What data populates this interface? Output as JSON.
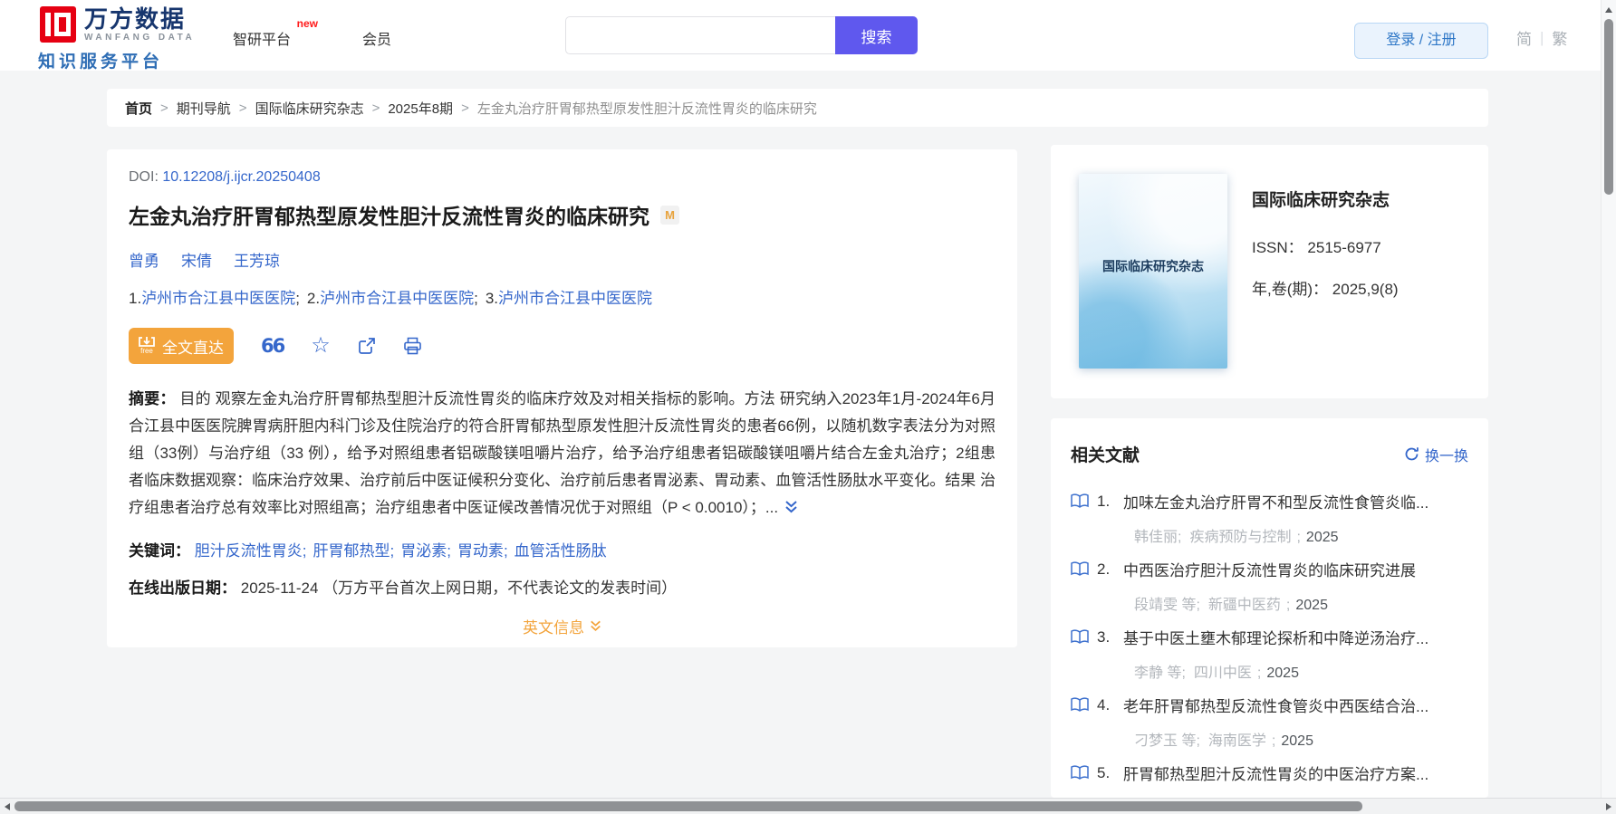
{
  "header": {
    "brand_cn": "万方数据",
    "brand_en": "WANFANG DATA",
    "subtitle": "知识服务平台",
    "nav": [
      {
        "label": "智研平台",
        "badge": "new"
      },
      {
        "label": "会员"
      }
    ],
    "search_value": "",
    "search_button": "搜索",
    "login": "登录 / 注册",
    "lang_divider": "|",
    "lang_simplified": "简",
    "lang_traditional": "繁"
  },
  "breadcrumb": {
    "separator": ">",
    "items": [
      "首页",
      "期刊导航",
      "国际临床研究杂志",
      "2025年8期",
      "左金丸治疗肝胃郁热型原发性胆汁反流性胃炎的临床研究"
    ]
  },
  "article": {
    "doi_label": "DOI: ",
    "doi": "10.12208/j.ijcr.20250408",
    "title": "左金丸治疗肝胃郁热型原发性胆汁反流性胃炎的临床研究",
    "badge": "M",
    "authors": [
      "曾勇",
      "宋倩",
      "王芳琼"
    ],
    "affil_sep": ";",
    "affiliations": [
      {
        "num": "1.",
        "name": "泸州市合江县中医医院"
      },
      {
        "num": "2.",
        "name": "泸州市合江县中医医院"
      },
      {
        "num": "3.",
        "name": "泸州市合江县中医医院"
      }
    ],
    "fulltext_label": "全文直达",
    "free_label": "free",
    "quote_icon": "66",
    "star_icon": "☆",
    "abstract_label": "摘要：",
    "abstract": "目的 观察左金丸治疗肝胃郁热型胆汁反流性胃炎的临床疗效及对相关指标的影响。方法 研究纳入2023年1月-2024年6月合江县中医医院脾胃病肝胆内科门诊及住院治疗的符合肝胃郁热型原发性胆汁反流性胃炎的患者66例，以随机数字表法分为对照组（33例）与治疗组（33 例），给予对照组患者铝碳酸镁咀嚼片治疗，给予治疗组患者铝碳酸镁咀嚼片结合左金丸治疗；2组患者临床数据观察：临床治疗效果、治疗前后中医证候积分变化、治疗前后患者胃泌素、胃动素、血管活性肠肽水平变化。结果 治疗组患者治疗总有效率比对照组高；治疗组患者中医证候改善情况优于对照组（P < 0.0010）；...",
    "keywords_label": "关键词：",
    "keyword_sep": ";",
    "keywords": [
      "胆汁反流性胃炎",
      "肝胃郁热型",
      "胃泌素",
      "胃动素",
      "血管活性肠肽"
    ],
    "pubdate_label": "在线出版日期：",
    "pubdate": "2025-11-24",
    "pubdate_note": "（万方平台首次上网日期，不代表论文的发表时间）",
    "english_info": "英文信息"
  },
  "journal": {
    "cover_text": "国际临床研究杂志",
    "name": "国际临床研究杂志",
    "issn_label": "ISSN：",
    "issn": "2515-6977",
    "vol_label": "年,卷(期)：",
    "vol": "2025,9(8)"
  },
  "related": {
    "title": "相关文献",
    "refresh_label": "换一换",
    "sep": ";",
    "items": [
      {
        "num": "1.",
        "title": "加味左金丸治疗肝胃不和型反流性食管炎临...",
        "authors": "韩佳丽;",
        "source": "疾病预防与控制",
        "year": "2025"
      },
      {
        "num": "2.",
        "title": "中西医治疗胆汁反流性胃炎的临床研究进展",
        "authors": "段靖雯 等;",
        "source": "新疆中医药",
        "year": "2025"
      },
      {
        "num": "3.",
        "title": "基于中医土壅木郁理论探析和中降逆汤治疗...",
        "authors": "李静 等;",
        "source": "四川中医",
        "year": "2025"
      },
      {
        "num": "4.",
        "title": "老年肝胃郁热型反流性食管炎中西医结合治...",
        "authors": "刁梦玉 等;",
        "source": "海南医学",
        "year": "2025"
      },
      {
        "num": "5.",
        "title": "肝胃郁热型胆汁反流性胃炎的中医治疗方案...",
        "authors": "",
        "source": "",
        "year": ""
      }
    ]
  },
  "colors": {
    "accent_blue": "#3567cb",
    "accent_orange": "#f3a43c",
    "accent_purple": "#5f58ee",
    "logo_red": "#e60012",
    "logo_navy": "#17366e",
    "logo_blue": "#2f6eb5",
    "badge_red": "#ff1a1a",
    "page_bg": "#f4f5f6"
  }
}
